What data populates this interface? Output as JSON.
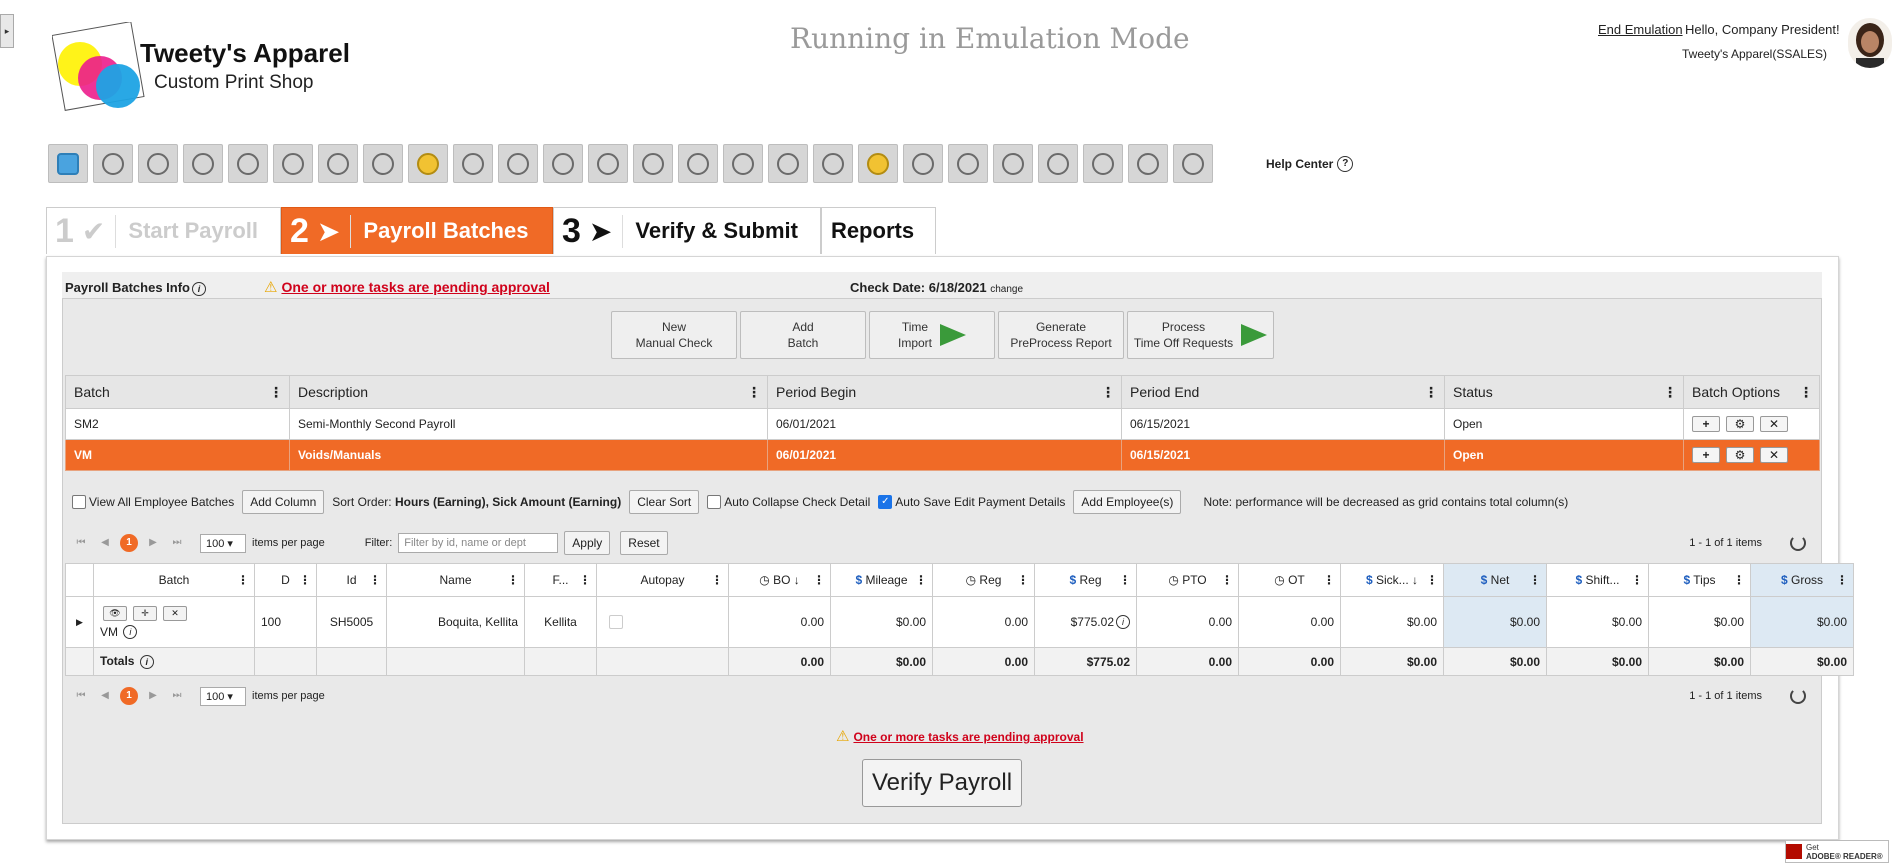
{
  "sidebar_toggle": "▸",
  "header": {
    "brand_name": "Tweety's Apparel",
    "brand_sub": "Custom Print Shop",
    "emulation_banner": "Running in Emulation Mode",
    "end_emulation": "End Emulation",
    "greeting": "Hello, Company President!",
    "company": "Tweety's Apparel(SSALES)"
  },
  "toolbar": {
    "icons": [
      "home-icon",
      "awards-icon",
      "settings-user-icon",
      "tax-icon",
      "people-icon",
      "team-icon",
      "org-chart-icon",
      "document-icon",
      "money-bag-icon",
      "target-icon",
      "target-alt-icon",
      "goal-icon",
      "radar-icon",
      "transfer-icon",
      "hand-icon",
      "shield-icon",
      "search-person-icon",
      "no-person-icon",
      "money-bag-alt-icon",
      "group-icon",
      "person-arrow-icon",
      "group-chart-icon",
      "search-money-icon",
      "gift-icon",
      "training-icon",
      "review-icon"
    ],
    "help_label": "Help Center",
    "help_glyph": "?"
  },
  "steps": [
    {
      "num": "1",
      "symbol": "✔",
      "label": "Start Payroll"
    },
    {
      "num": "2",
      "symbol": "➤",
      "label": "Payroll Batches"
    },
    {
      "num": "3",
      "symbol": "➤",
      "label": "Verify & Submit"
    },
    {
      "label": "Reports"
    }
  ],
  "info": {
    "title": "Payroll Batches Info",
    "pending_warning": "One or more tasks are pending approval",
    "check_date_label": "Check Date: 6/18/2021",
    "change_label": "change"
  },
  "actions": {
    "new_manual_check": [
      "New",
      "Manual Check"
    ],
    "add_batch": [
      "Add",
      "Batch"
    ],
    "time_import": [
      "Time",
      "Import"
    ],
    "generate_report": [
      "Generate",
      "PreProcess Report"
    ],
    "process_time_off": [
      "Process",
      "Time Off Requests"
    ]
  },
  "batch_grid": {
    "headers": [
      "Batch",
      "Description",
      "Period Begin",
      "Period End",
      "Status",
      "Batch Options"
    ],
    "rows": [
      {
        "batch": "SM2",
        "description": "Semi-Monthly Second Payroll",
        "begin": "06/01/2021",
        "end": "06/15/2021",
        "status": "Open"
      },
      {
        "batch": "VM",
        "description": "Voids/Manuals",
        "begin": "06/01/2021",
        "end": "06/15/2021",
        "status": "Open"
      }
    ],
    "option_glyphs": [
      "+",
      "⚙",
      "✕"
    ]
  },
  "emp_toolbar": {
    "view_all": "View All Employee Batches",
    "add_column": "Add Column",
    "sort_order_label": "Sort Order:",
    "sort_order_value": "Hours (Earning), Sick Amount (Earning)",
    "clear_sort": "Clear Sort",
    "auto_collapse": "Auto Collapse Check Detail",
    "auto_save": "Auto Save Edit Payment Details",
    "add_employees": "Add Employee(s)",
    "note": "Note: performance will be decreased as grid contains total column(s)"
  },
  "pager_top": {
    "page": "1",
    "page_size": "100",
    "items_per_page": "items per page",
    "filter_label": "Filter:",
    "filter_placeholder": "Filter by id, name or dept",
    "apply": "Apply",
    "reset": "Reset",
    "count": "1 - 1 of 1 items"
  },
  "emp_grid": {
    "headers": [
      "Batch",
      "D",
      "Id",
      "Name",
      "F...",
      "Autopay",
      "BO",
      "Mileage",
      "Reg",
      "Reg",
      "PTO",
      "OT",
      "Sick...",
      "Net",
      "Shift...",
      "Tips",
      "Gross"
    ],
    "row": {
      "batch": "VM",
      "d": "100",
      "id": "SH5005",
      "name": "Boquita, Kellita",
      "first": "Kellita",
      "values": [
        "0.00",
        "$0.00",
        "0.00",
        "$775.02",
        "0.00",
        "0.00",
        "$0.00",
        "$0.00",
        "$0.00",
        "$0.00",
        "$0.00"
      ]
    },
    "totals_label": "Totals",
    "totals": [
      "0.00",
      "$0.00",
      "0.00",
      "$775.02",
      "0.00",
      "0.00",
      "$0.00",
      "$0.00",
      "$0.00",
      "$0.00",
      "$0.00"
    ]
  },
  "pager_bottom": {
    "page": "1",
    "page_size": "100",
    "items_per_page": "items per page",
    "count": "1 - 1 of 1 items"
  },
  "bottom": {
    "pending_warning": "One or more tasks are pending approval",
    "verify_button": "Verify Payroll",
    "adobe_small": "Get",
    "adobe_label": "ADOBE® READER®"
  },
  "colors": {
    "accent": "#f06a26",
    "warning": "#d0021b",
    "highlight_col": "#dde9f3"
  }
}
